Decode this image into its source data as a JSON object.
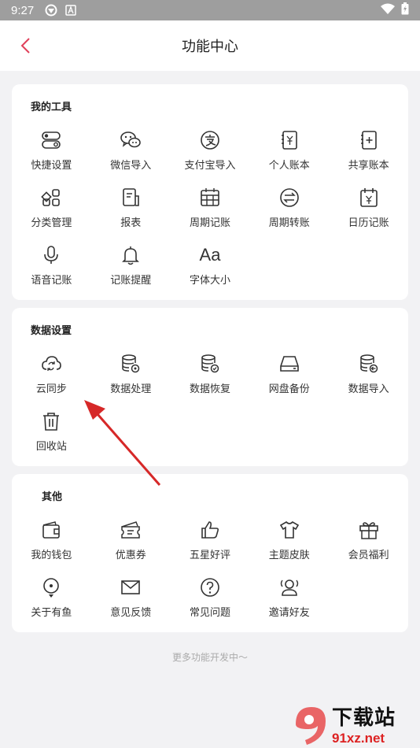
{
  "status": {
    "time": "9:27"
  },
  "header": {
    "title": "功能中心"
  },
  "sections": {
    "tools": {
      "title": "我的工具",
      "items": [
        {
          "label": "快捷设置",
          "icon": "toggle-settings-icon"
        },
        {
          "label": "微信导入",
          "icon": "wechat-icon"
        },
        {
          "label": "支付宝导入",
          "icon": "alipay-icon"
        },
        {
          "label": "个人账本",
          "icon": "personal-ledger-icon"
        },
        {
          "label": "共享账本",
          "icon": "shared-ledger-icon"
        },
        {
          "label": "分类管理",
          "icon": "category-grid-icon"
        },
        {
          "label": "报表",
          "icon": "report-icon"
        },
        {
          "label": "周期记账",
          "icon": "calendar-grid-icon"
        },
        {
          "label": "周期转账",
          "icon": "transfer-arrows-icon"
        },
        {
          "label": "日历记账",
          "icon": "calendar-yen-icon"
        },
        {
          "label": "语音记账",
          "icon": "microphone-icon"
        },
        {
          "label": "记账提醒",
          "icon": "bell-icon"
        },
        {
          "label": "字体大小",
          "icon": "font-size-icon",
          "glyph": "Aa"
        }
      ]
    },
    "data": {
      "title": "数据设置",
      "items": [
        {
          "label": "云同步",
          "icon": "cloud-sync-icon"
        },
        {
          "label": "数据处理",
          "icon": "database-settings-icon"
        },
        {
          "label": "数据恢复",
          "icon": "database-check-icon"
        },
        {
          "label": "网盘备份",
          "icon": "drive-icon"
        },
        {
          "label": "数据导入",
          "icon": "database-import-icon"
        },
        {
          "label": "回收站",
          "icon": "trash-icon"
        }
      ]
    },
    "other": {
      "title": "其他",
      "items": [
        {
          "label": "我的钱包",
          "icon": "wallet-icon"
        },
        {
          "label": "优惠券",
          "icon": "coupon-icon"
        },
        {
          "label": "五星好评",
          "icon": "thumbs-up-icon"
        },
        {
          "label": "主题皮肤",
          "icon": "tshirt-icon"
        },
        {
          "label": "会员福利",
          "icon": "gift-icon"
        },
        {
          "label": "关于有鱼",
          "icon": "location-pin-icon"
        },
        {
          "label": "意见反馈",
          "icon": "envelope-icon"
        },
        {
          "label": "常见问题",
          "icon": "question-icon"
        },
        {
          "label": "邀请好友",
          "icon": "invite-friends-icon"
        }
      ]
    }
  },
  "footer": {
    "note": "更多功能开发中～"
  },
  "watermark": {
    "text": "下载站",
    "url": "91xz.net"
  },
  "colors": {
    "accent": "#e0405a",
    "arrow": "#d62828"
  }
}
